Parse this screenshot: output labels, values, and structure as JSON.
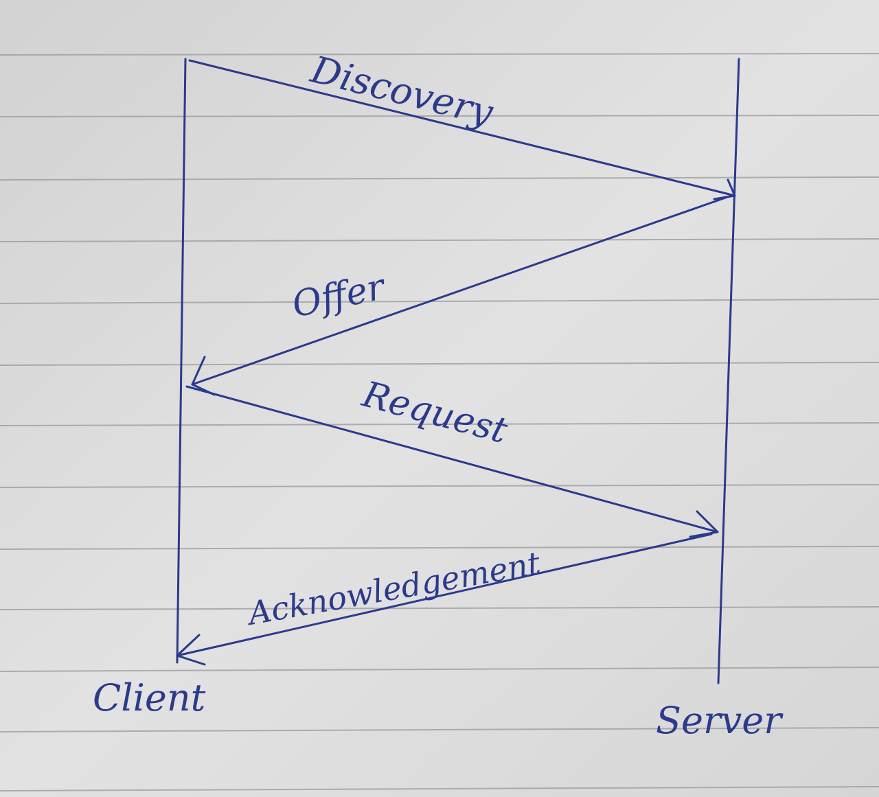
{
  "diagram": {
    "lifelines": [
      {
        "id": "client",
        "label": "Client"
      },
      {
        "id": "server",
        "label": "Server"
      }
    ],
    "messages": [
      {
        "id": "discovery",
        "label": "Discovery",
        "from": "client",
        "to": "server"
      },
      {
        "id": "offer",
        "label": "Offer",
        "from": "server",
        "to": "client"
      },
      {
        "id": "request",
        "label": "Request",
        "from": "client",
        "to": "server"
      },
      {
        "id": "acknowledgement",
        "label": "Acknowledgement",
        "from": "server",
        "to": "client"
      }
    ]
  },
  "colors": {
    "ink": "#2b3a8c",
    "paper": "#dcdcdc",
    "rule_line": "#9a9a9a"
  }
}
